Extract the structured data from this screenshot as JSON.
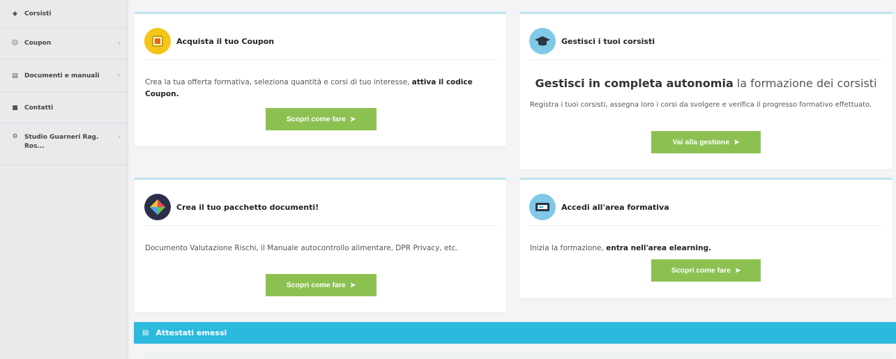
{
  "sidebar": {
    "items": [
      {
        "label": "Corsisti",
        "icon": "graduation-cap-icon"
      },
      {
        "label": "Coupon",
        "icon": "users-icon"
      },
      {
        "label": "Documenti e manuali",
        "icon": "document-icon"
      },
      {
        "label": "Contatti",
        "icon": "contacts-icon"
      },
      {
        "label": "Studio Guarneri Rag. Ros...",
        "icon": "gear-icon"
      }
    ]
  },
  "cards": {
    "coupon": {
      "title": "Acquista il tuo Coupon",
      "body": "Crea la tua offerta formativa, seleziona quantità e corsi di tuo interesse,",
      "body_bold": "attiva il codice Coupon.",
      "button": "Scopri come fare"
    },
    "corsisti": {
      "title": "Gestisci i tuoi corsisti",
      "hero_bold": "Gestisci in completa autonomia",
      "hero_rest": "la formazione dei corsisti",
      "body": "Registra i tuoi corsisti, assegna loro i corsi da svolgere e verifica il progresso formativo effettuato.",
      "button": "Vai alla gestione"
    },
    "documenti": {
      "title": "Crea il tuo pacchetto documenti!",
      "body": "Documento Valutazione Rischi, il Manuale autocontrollo alimentare, DPR Privacy, etc.",
      "button": "Scopri come fare"
    },
    "formativa": {
      "title": "Accedi all'area formativa",
      "body": "Inizia la formazione,",
      "body_bold": "entra nell'area elearning.",
      "button": "Scopri come fare"
    }
  },
  "attestati": {
    "label": "Attestati emessi"
  },
  "colors": {
    "accent_green": "#8cc152",
    "accent_blue": "#2cb9de",
    "card_border": "#bfe3ef",
    "sidebar_bg": "#e9eaec"
  }
}
